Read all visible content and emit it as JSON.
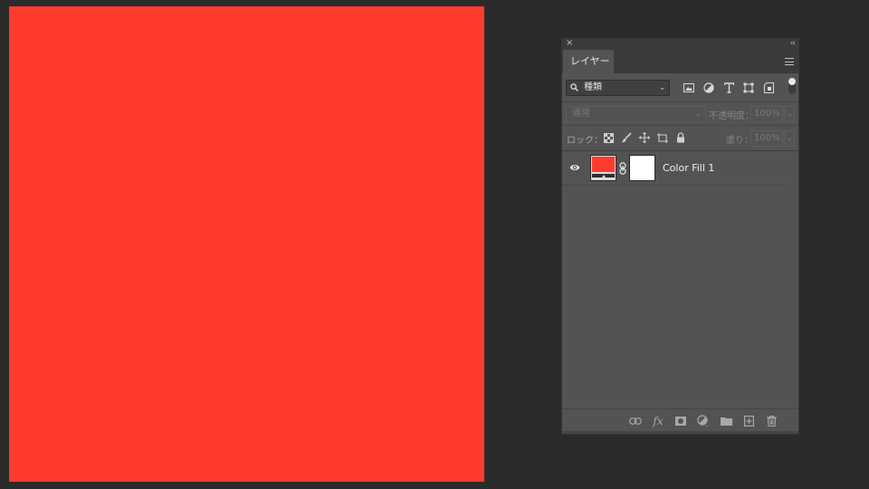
{
  "colors": {
    "fill": "#ff3b2e",
    "mask": "#ffffff"
  },
  "panel": {
    "close_glyph": "×",
    "collapse_glyph": "‹‹",
    "tab_label": "レイヤー"
  },
  "filter": {
    "kind_label": "種類",
    "icons": [
      "image-filter-icon",
      "adjustment-filter-icon",
      "type-filter-icon",
      "shape-filter-icon",
      "smart-object-filter-icon"
    ]
  },
  "blend": {
    "mode": "通常",
    "opacity_label": "不透明度：",
    "opacity_value": "100%"
  },
  "lock": {
    "label": "ロック：",
    "fill_label": "塗り：",
    "fill_value": "100%"
  },
  "layers": [
    {
      "name": "Color Fill 1",
      "visible": true
    }
  ],
  "footer": {
    "fx_label": "fx"
  }
}
